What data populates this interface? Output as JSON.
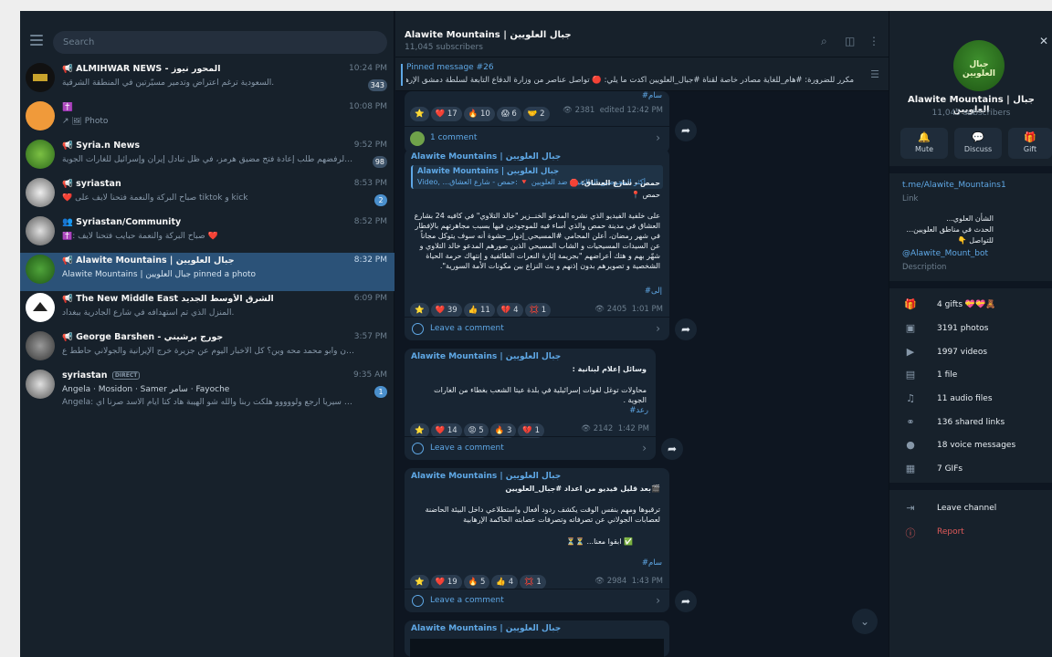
{
  "window": {
    "minimize": "—",
    "maximize": "☐"
  },
  "sidebar": {
    "search_placeholder": "Search",
    "chats": [
      {
        "name": "📢 ALMIHWAR NEWS - المحور نيوز",
        "time": "10:24 PM",
        "preview": "السعودية ترغم اعتراض وتدمير مسيّرتين في المنطقة الشرقية.",
        "badge": "343",
        "avatar": "#111111"
      },
      {
        "name": "✝️",
        "time": "10:08 PM",
        "preview": "↗ 🖼 Photo",
        "badge": "",
        "avatar": "#f09a3a"
      },
      {
        "name": "📢 Syria.n News",
        "time": "9:52 PM",
        "preview": "انتقد ترامب حلفاءه لرفضهم طلب إعادة فتح مضيق هرمز، في ظل تبادل إيران وإسرائيل للغارات الجوية.",
        "badge": "98",
        "avatar": "#3a7d2a"
      },
      {
        "name": "📢 syriastan",
        "time": "8:53 PM",
        "preview": "❤️ صباح البركة والنعمة فتحنا لايف على tiktok و kick",
        "badge": "2",
        "avatar": "#dddddd"
      },
      {
        "name": "👥 Syriastan/Community",
        "time": "8:52 PM",
        "preview": "✝️: صباح البركة والنعمة حبايب فتحنا لايف ❤️",
        "badge": "",
        "avatar": "#cccccc"
      },
      {
        "name": "📢 Alawite Mountains | جبال العلويين",
        "time": "8:32 PM",
        "preview": "Alawite Mountains | جبال العلويين pinned a photo",
        "badge": "",
        "avatar": "#3a8a2a"
      },
      {
        "name": "📢 The New Middle East الشرق الأوسط الجديد",
        "time": "6:09 PM",
        "preview": "المنزل الذي تم استهدافه في شارع الجادرية ببغداد.",
        "badge": "",
        "avatar": "#ffffff"
      },
      {
        "name": "📢 George Barshen - جورج برشيني",
        "time": "3:57 PM",
        "preview": "العالم بحرب أميركا و إيران وأبو محمد محه وين؟ كل الأخبار اليوم عن جزيرة خرج الإيرانية والجولاني حاطط ع...",
        "badge": "",
        "avatar": "#888888"
      },
      {
        "name": "syriastan",
        "time": "9:35 AM",
        "direct": "DIRECT",
        "preview": "Angela · Mosidon · Samer سامر · Fayoche",
        "preview2": "Angela: اشتقنا لك كتير سيريا ارجع ولووووو هلكت ربنا والله شو الهيبة هاد كتا أيام الاسد صرنا أي...",
        "badge": "1",
        "avatar": "#bbbbbb"
      }
    ]
  },
  "header": {
    "title": "Alawite Mountains | جبال العلويين",
    "subtitle": "11,045 subscribers"
  },
  "pinned": {
    "title": "Pinned message #26",
    "text": "مكرر للضرورة: #هام_للغاية  مصادر خاصة لقناة #جبال_العلويين أكدت ما يلي: 🔴 تواصل عناصر من وزارة الدفاع التابعة لسلطة دمشق الإرهـــاب..."
  },
  "messages": [
    {
      "hashtag": "#سام",
      "reactions": [
        "⭐",
        "❤️ 17",
        "🔥 10",
        "😱 6",
        "🤝 2"
      ],
      "views": "2381",
      "time": "edited 12:42 PM",
      "comment": "1 comment"
    },
    {
      "author": "Alawite Mountains | جبال العلويين",
      "reply_author": "Alawite Mountains | جبال العلويين",
      "reply_text": "Video, ...أكثر المحرضين الطائفيين ضد العلويين 🔻 :حمص - شارع العشاق",
      "header": "حمص - شارع العشاق: 🛑",
      "header2": "حمص 📍",
      "body": "على خلفية الفيديو الذي نشره المدعو الخنــزير \"خالد التلاوي\" في كافيه 24 بشارع العشاق في مدينة حمص والذي أساء فيه للموجودين فيها بسبب مجاهرتهم بالإفطار في شهر رمضان، أعلن المحامي #المسيحي_إدوار_حشوة أنه سوف يتوكل مجاناً عن السيدات المسيحيات و الشاب المسيحي الذين صورهم المدعو خالد التلاوي و شهّر بهم و هتك أعراضهم \"بجريمة إثارة النعرات الطائفية و إنتهاك حرمة الحياة الشخصية و تصويرهم بدون إذنهم و بث النزاع بين مكونات الأمة السورية\".",
      "hashtag": "#إلى",
      "reactions": [
        "⭐",
        "❤️ 39",
        "👍 11",
        "💔 4",
        "💢 1"
      ],
      "views": "2405",
      "time": "1:01 PM",
      "comment": "Leave a comment"
    },
    {
      "author": "Alawite Mountains | جبال العلويين",
      "header": "وسائل إعلام لبنانية :",
      "body": "محاولات توغل لقوات إسرائيلية في بلدة عيتا الشعب بغطاء من الغارات الجوية .",
      "hashtag": "#رعد",
      "reactions": [
        "⭐",
        "❤️ 14",
        "😡 5",
        "🔥 3",
        "💔 1"
      ],
      "views": "2142",
      "time": "1:42 PM",
      "comment": "Leave a comment"
    },
    {
      "author": "Alawite Mountains | جبال العلويين",
      "header": "🎬بعد قليل فيديو من اعداد #جبال_العلويين",
      "body": "ترقبوها ومهم بنفس الوقت يكشف ردود أفعال واستطلاعي داخل البيئة الحاضنة لعصابات الجولاني عن تصرفاته وتصرفات عصابته الحاكمة الإرهابية",
      "body2": "✅ ابقوا معنا... ⏳⏳",
      "hashtag": "#سام",
      "reactions": [
        "⭐",
        "❤️ 19",
        "🔥 5",
        "👍 4",
        "💢 1"
      ],
      "views": "2984",
      "time": "1:43 PM",
      "comment": "Leave a comment"
    },
    {
      "author": "Alawite Mountains | جبال العلويين"
    }
  ],
  "profile": {
    "name": "Alawite Mountains | جبال العلويين",
    "subscribers": "11,045 subscribers",
    "avatar_text": "جبال العلويين",
    "buttons": [
      {
        "label": "Mute",
        "icon": "bell-icon"
      },
      {
        "label": "Discuss",
        "icon": "chat-bubble-icon"
      },
      {
        "label": "Gift",
        "icon": "gift-icon"
      }
    ],
    "link": "t.me/Alawite_Mountains1",
    "link_label": "Link",
    "description": "الشأن العلوي...\nالحدث في مناطق العلويين...\nللتواصل 👇",
    "bot": "@Alawite_Mount_bot",
    "description_label": "Description",
    "media": [
      {
        "label": "4 gifts 💝💝🧸",
        "icon": "gift-icon",
        "glyph": "🎁"
      },
      {
        "label": "3191 photos",
        "icon": "photo-icon",
        "glyph": "▣"
      },
      {
        "label": "1997 videos",
        "icon": "video-icon",
        "glyph": "▶"
      },
      {
        "label": "1 file",
        "icon": "file-icon",
        "glyph": "▤"
      },
      {
        "label": "11 audio files",
        "icon": "headphones-icon",
        "glyph": "♫"
      },
      {
        "label": "136 shared links",
        "icon": "link-icon",
        "glyph": "⚭"
      },
      {
        "label": "18 voice messages",
        "icon": "microphone-icon",
        "glyph": "●"
      },
      {
        "label": "7 GIFs",
        "icon": "gif-icon",
        "glyph": "▦"
      }
    ],
    "leave": "Leave channel",
    "report": "Report"
  }
}
